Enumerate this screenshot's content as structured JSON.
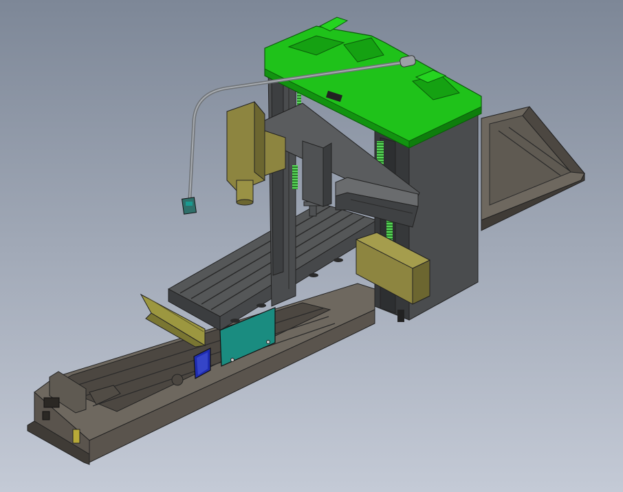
{
  "viewport": {
    "background_top": "#7d8797",
    "background_bottom": "#c4cad6"
  },
  "model": {
    "components": [
      "machine-bed",
      "worktable",
      "gantry-column-left",
      "gantry-column-right",
      "gantry-top-beam",
      "cross-rail",
      "spindle-head",
      "side-spindle-head",
      "pendant-arm",
      "control-pendant",
      "chip-guard",
      "control-panel",
      "electrical-box",
      "indicator-plate"
    ],
    "colors": {
      "bed": "#5a544d",
      "bed_dark": "#3f3b36",
      "bed_light": "#6e685f",
      "table": "#555758",
      "table_dark": "#3b3d3f",
      "column": "#4a4c4e",
      "column_dark": "#36383a",
      "green_top": "#1fc21a",
      "green_dark": "#129310",
      "spindle": "#8d8540",
      "spindle_dark": "#6c6630",
      "panel_teal": "#1a8c80",
      "box_blue": "#1e2cb0",
      "guard_yellow": "#9c9740",
      "spring_green": "#3fbf3f",
      "pendant_body": "#2f6f6a"
    }
  }
}
